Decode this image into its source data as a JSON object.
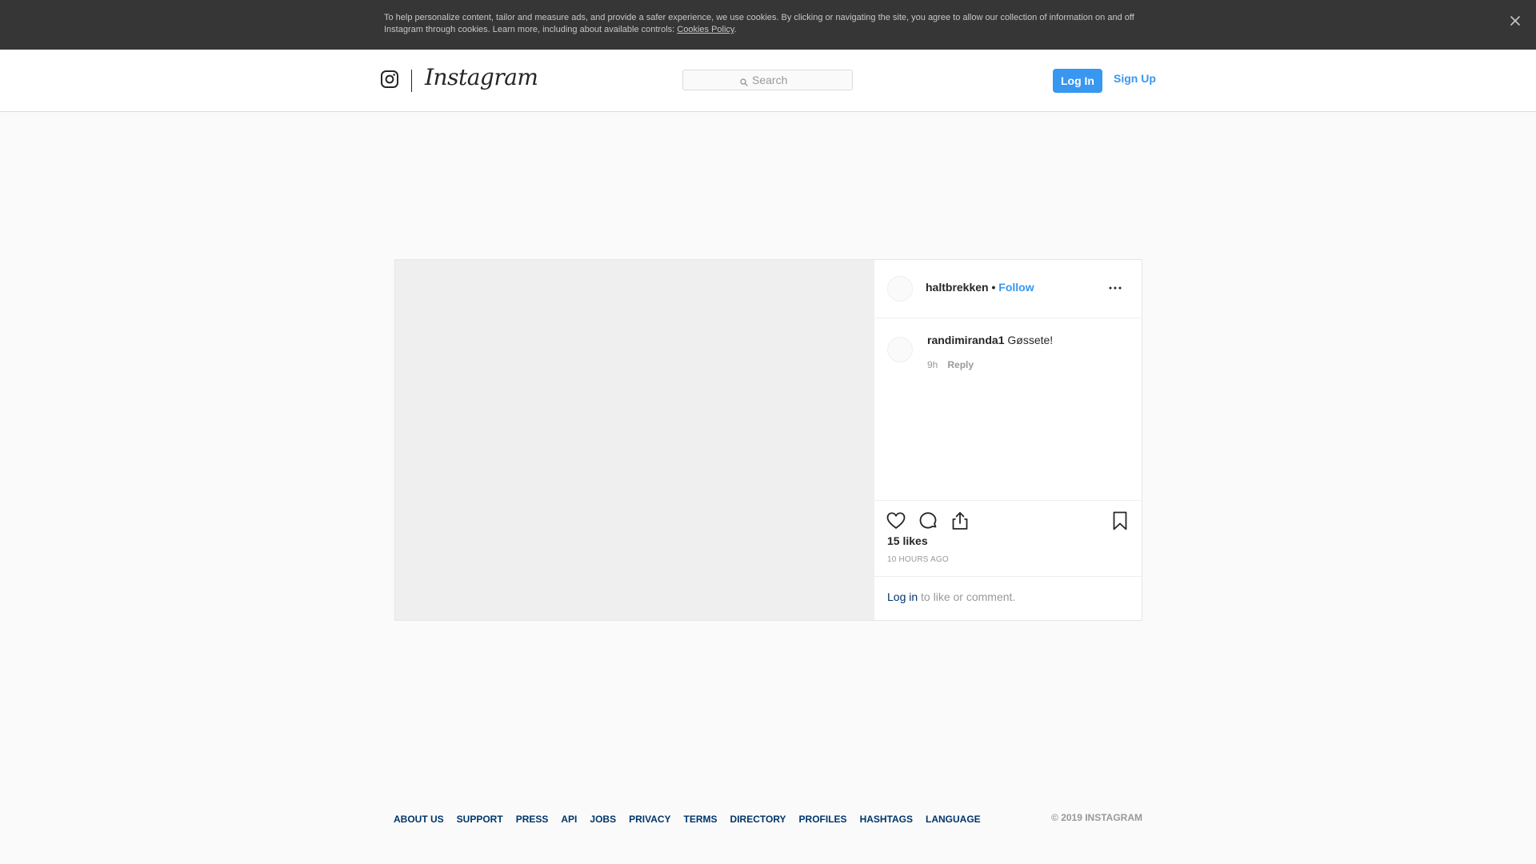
{
  "cookie_banner": {
    "text": "To help personalize content, tailor and measure ads, and provide a safer experience, we use cookies. By clicking or navigating the site, you agree to allow our collection of information on and off Instagram through cookies. Learn more, including about available controls: ",
    "policy_link": "Cookies Policy",
    "end_punct": ".",
    "close_icon": "close-icon"
  },
  "header": {
    "logo_icon": "instagram-glyph-icon",
    "wordmark": "Instagram",
    "search": {
      "placeholder": "Search",
      "icon": "search-icon"
    },
    "login_label": "Log In",
    "signup_label": "Sign Up",
    "accent_color": "#3897f0"
  },
  "post": {
    "owner": {
      "username": "haltbrekken",
      "separator": "•",
      "follow_label": "Follow"
    },
    "more_icon": "more-options-icon",
    "comments": [
      {
        "username": "randimiranda1",
        "text": "Gøssete!",
        "time": "9h",
        "reply_label": "Reply"
      }
    ],
    "actions": {
      "like_icon": "heart-icon",
      "comment_icon": "comment-icon",
      "share_icon": "share-icon",
      "save_icon": "bookmark-icon"
    },
    "likes": "15 likes",
    "time_ago": "10 HOURS AGO",
    "login_prompt": {
      "link": "Log in",
      "rest": " to like or comment."
    }
  },
  "footer": {
    "links": [
      "ABOUT US",
      "SUPPORT",
      "PRESS",
      "API",
      "JOBS",
      "PRIVACY",
      "TERMS",
      "DIRECTORY",
      "PROFILES",
      "HASHTAGS",
      "LANGUAGE"
    ],
    "copyright": "© 2019 INSTAGRAM"
  }
}
